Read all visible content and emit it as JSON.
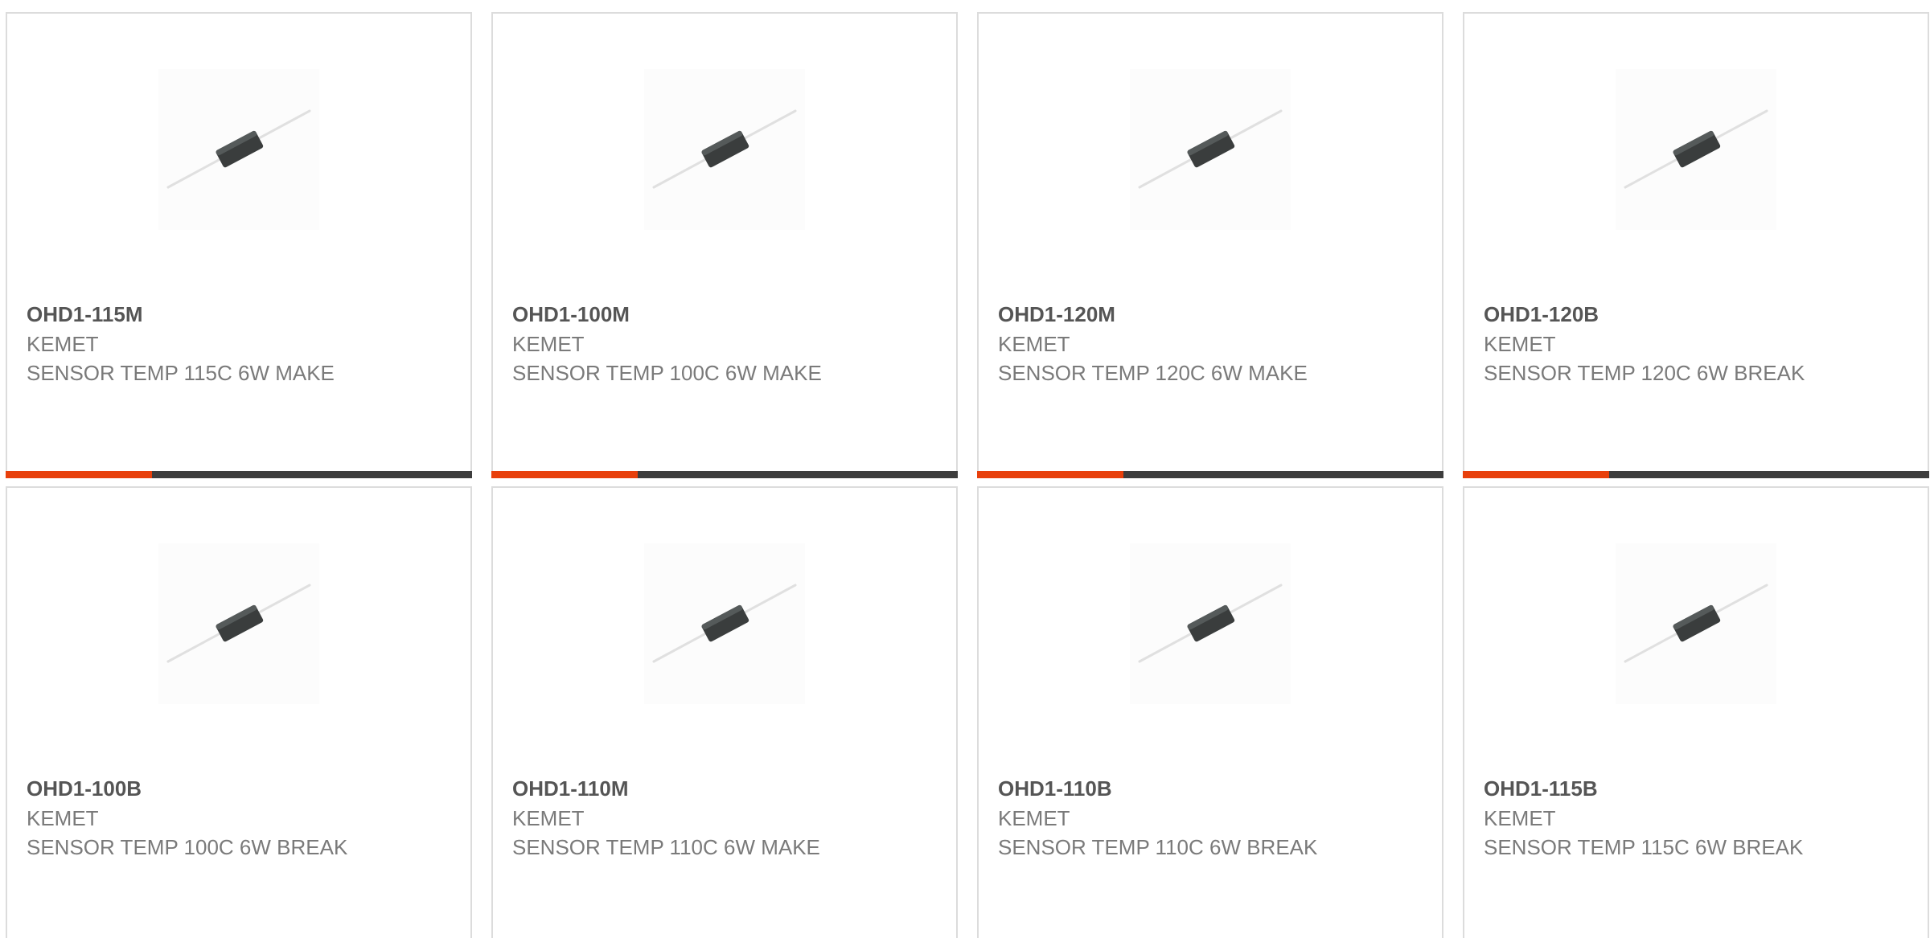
{
  "product_image_icon": "axial-thermal-sensor-icon",
  "colors": {
    "accent": "#e8400c",
    "bar": "#3d3d3d",
    "border": "#dcdcdc",
    "part_text": "#555555",
    "secondary_text": "#7a7a7a"
  },
  "products": [
    {
      "part": "OHD1-115M",
      "manufacturer": "KEMET",
      "description": "SENSOR TEMP 115C 6W MAKE"
    },
    {
      "part": "OHD1-100M",
      "manufacturer": "KEMET",
      "description": "SENSOR TEMP 100C 6W MAKE"
    },
    {
      "part": "OHD1-120M",
      "manufacturer": "KEMET",
      "description": "SENSOR TEMP 120C 6W MAKE"
    },
    {
      "part": "OHD1-120B",
      "manufacturer": "KEMET",
      "description": "SENSOR TEMP 120C 6W BREAK"
    },
    {
      "part": "OHD1-100B",
      "manufacturer": "KEMET",
      "description": "SENSOR TEMP 100C 6W BREAK"
    },
    {
      "part": "OHD1-110M",
      "manufacturer": "KEMET",
      "description": "SENSOR TEMP 110C 6W MAKE"
    },
    {
      "part": "OHD1-110B",
      "manufacturer": "KEMET",
      "description": "SENSOR TEMP 110C 6W BREAK"
    },
    {
      "part": "OHD1-115B",
      "manufacturer": "KEMET",
      "description": "SENSOR TEMP 115C 6W BREAK"
    }
  ]
}
